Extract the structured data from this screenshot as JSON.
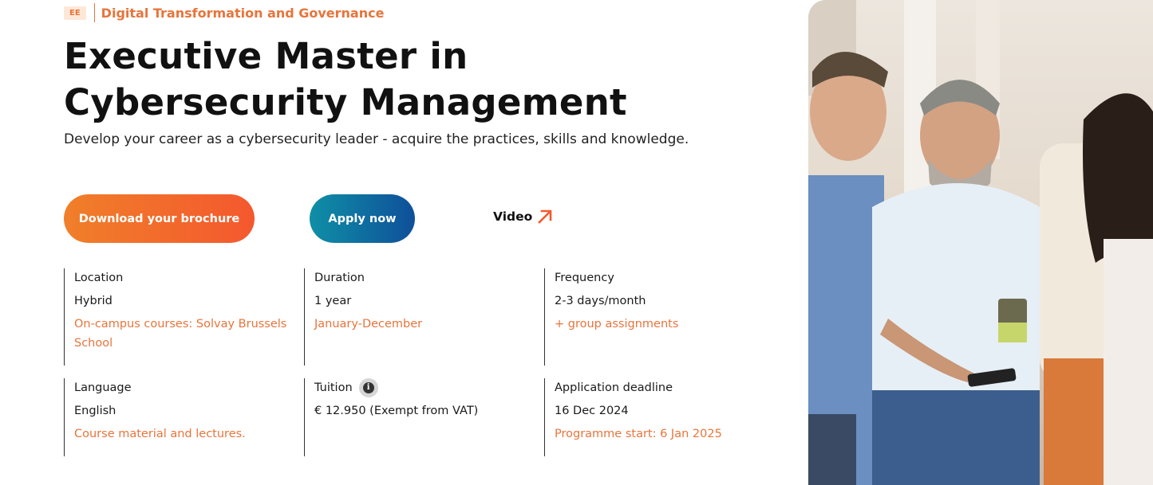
{
  "breadcrumb": {
    "tag": "EE",
    "label": "Digital Transformation and Governance"
  },
  "hero": {
    "title": "Executive Master in Cybersecurity Management",
    "subtitle": "Develop your career as a cybersecurity leader - acquire the practices, skills and knowledge."
  },
  "actions": {
    "brochure_label": "Download your brochure",
    "apply_label": "Apply now",
    "video_label": "Video"
  },
  "info": {
    "location": {
      "label": "Location",
      "value": "Hybrid",
      "note": "On-campus courses: Solvay Brussels School"
    },
    "duration": {
      "label": "Duration",
      "value": "1 year",
      "note": "January-December"
    },
    "frequency": {
      "label": "Frequency",
      "value": "2-3 days/month",
      "note": "+ group assignments"
    },
    "language": {
      "label": "Language",
      "value": "English",
      "note": "Course material and lectures."
    },
    "tuition": {
      "label": "Tuition",
      "value": "€ 12.950  (Exempt from VAT)",
      "info_icon": "i"
    },
    "deadline": {
      "label": "Application deadline",
      "value": "16 Dec 2024",
      "note": "Programme start: 6 Jan 2025"
    }
  },
  "colors": {
    "accent_orange": "#e8743b",
    "brochure_gradient": [
      "#f07f2a",
      "#f4582e"
    ],
    "apply_gradient": [
      "#0f8fa6",
      "#0f4f9a"
    ]
  }
}
